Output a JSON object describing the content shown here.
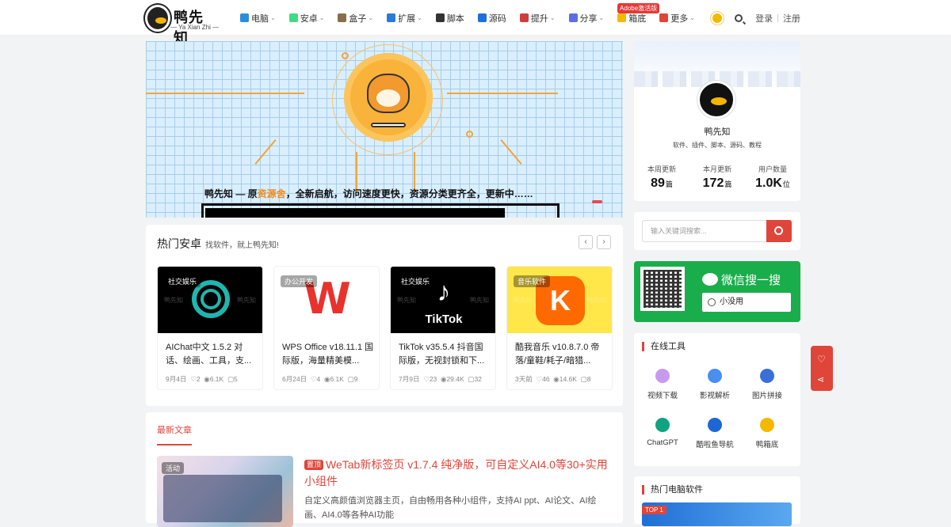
{
  "header": {
    "logo_text": "鸭先知",
    "logo_sub": "— Ya Xian Zhi —",
    "nav": [
      {
        "label": "电脑",
        "icon": "windows-icon",
        "color": "#2b8de0",
        "dropdown": true
      },
      {
        "label": "安卓",
        "icon": "android-icon",
        "color": "#3ddc84",
        "dropdown": true
      },
      {
        "label": "盒子",
        "icon": "box-icon",
        "color": "#8a6d4a",
        "dropdown": true
      },
      {
        "label": "扩展",
        "icon": "puzzle-icon",
        "color": "#2a7ad8",
        "dropdown": true
      },
      {
        "label": "脚本",
        "icon": "script-icon",
        "color": "#333333",
        "dropdown": false
      },
      {
        "label": "源码",
        "icon": "code-icon",
        "color": "#1d6fe0",
        "dropdown": false
      },
      {
        "label": "提升",
        "icon": "rocket-icon",
        "color": "#d03b3b",
        "dropdown": true
      },
      {
        "label": "分享",
        "icon": "send-icon",
        "color": "#5b6ee8",
        "dropdown": true
      },
      {
        "label": "箱底",
        "icon": "duck-icon",
        "color": "#f5b800",
        "dropdown": false
      },
      {
        "label": "更多",
        "icon": "grid-icon",
        "color": "#e0453a",
        "dropdown": true
      }
    ],
    "adobe_badge": "Adobe激活版",
    "login": "登录",
    "register": "注册"
  },
  "banner": {
    "text_before": "鸭先知 — 原",
    "text_highlight": "资源舍",
    "text_after": "，全新启航，访问速度更快，资源分类更齐全，更新中……"
  },
  "hot": {
    "title": "热门安卓",
    "subtitle": "找软件，就上鸭先知!",
    "watermark": "鸭先知",
    "apps": [
      {
        "category": "社交娱乐",
        "name": "AIChat中文 1.5.2 对话、绘画、工具，支...",
        "date": "9月4日",
        "likes": "2",
        "views": "6.1K",
        "comments": "5",
        "bg": "#000000",
        "fg": "#1fb6b0"
      },
      {
        "category": "办公开发",
        "name": "WPS Office v18.11.1 国际版，海量精美模...",
        "date": "6月24日",
        "likes": "4",
        "views": "6.1K",
        "comments": "9",
        "bg": "#ffffff",
        "fg": "#e8322d"
      },
      {
        "category": "社交娱乐",
        "name": "TikTok v35.5.4 抖音国际版，无视封锁和下...",
        "date": "7月9日",
        "likes": "23",
        "views": "29.4K",
        "comments": "32",
        "bg": "#000000",
        "fg": "#ffffff",
        "logo_text": "TikTok"
      },
      {
        "category": "音乐软件",
        "name": "酷我音乐 v10.8.7.0 帝落/童鞋/耗子/暗猎...",
        "date": "3天前",
        "likes": "46",
        "views": "14.6K",
        "comments": "8",
        "bg": "#ffe74a",
        "fg": "#ff6a00"
      }
    ]
  },
  "latest": {
    "tab": "最新文章",
    "thumb_badge": "活动",
    "top_badge": "置顶",
    "title": "WeTab新标签页 v1.7.4 纯净版，可自定义AI4.0等30+实用小组件",
    "desc": "自定义高颜值浏览器主页，自由畅用各种小组件，支持AI ppt、AI论文、AI绘画、AI4.0等各种AI功能"
  },
  "profile": {
    "name": "鸭先知",
    "desc": "软件、插件、脚本、源码、教程",
    "stats": [
      {
        "label": "本周更新",
        "value": "89",
        "unit": "篇"
      },
      {
        "label": "本月更新",
        "value": "172",
        "unit": "篇"
      },
      {
        "label": "用户数量",
        "value": "1.0K",
        "unit": "位"
      }
    ]
  },
  "search": {
    "placeholder": "输入关键词搜索..."
  },
  "wechat": {
    "title": "微信搜一搜",
    "query": "小没用"
  },
  "tools": {
    "title": "在线工具",
    "items": [
      {
        "label": "视频下载",
        "color": "#c79af0"
      },
      {
        "label": "影视解析",
        "color": "#4a8ef0"
      },
      {
        "label": "图片拼接",
        "color": "#3a6fd8"
      },
      {
        "label": "ChatGPT",
        "color": "#10a37f"
      },
      {
        "label": "酷啦鱼导航",
        "color": "#1e66d4"
      },
      {
        "label": "鸭箱底",
        "color": "#f5b800"
      }
    ]
  },
  "pc": {
    "title": "热门电脑软件",
    "badge": "TOP 1"
  },
  "colors": {
    "accent": "#e0453a",
    "wechat": "#1aad4b"
  }
}
